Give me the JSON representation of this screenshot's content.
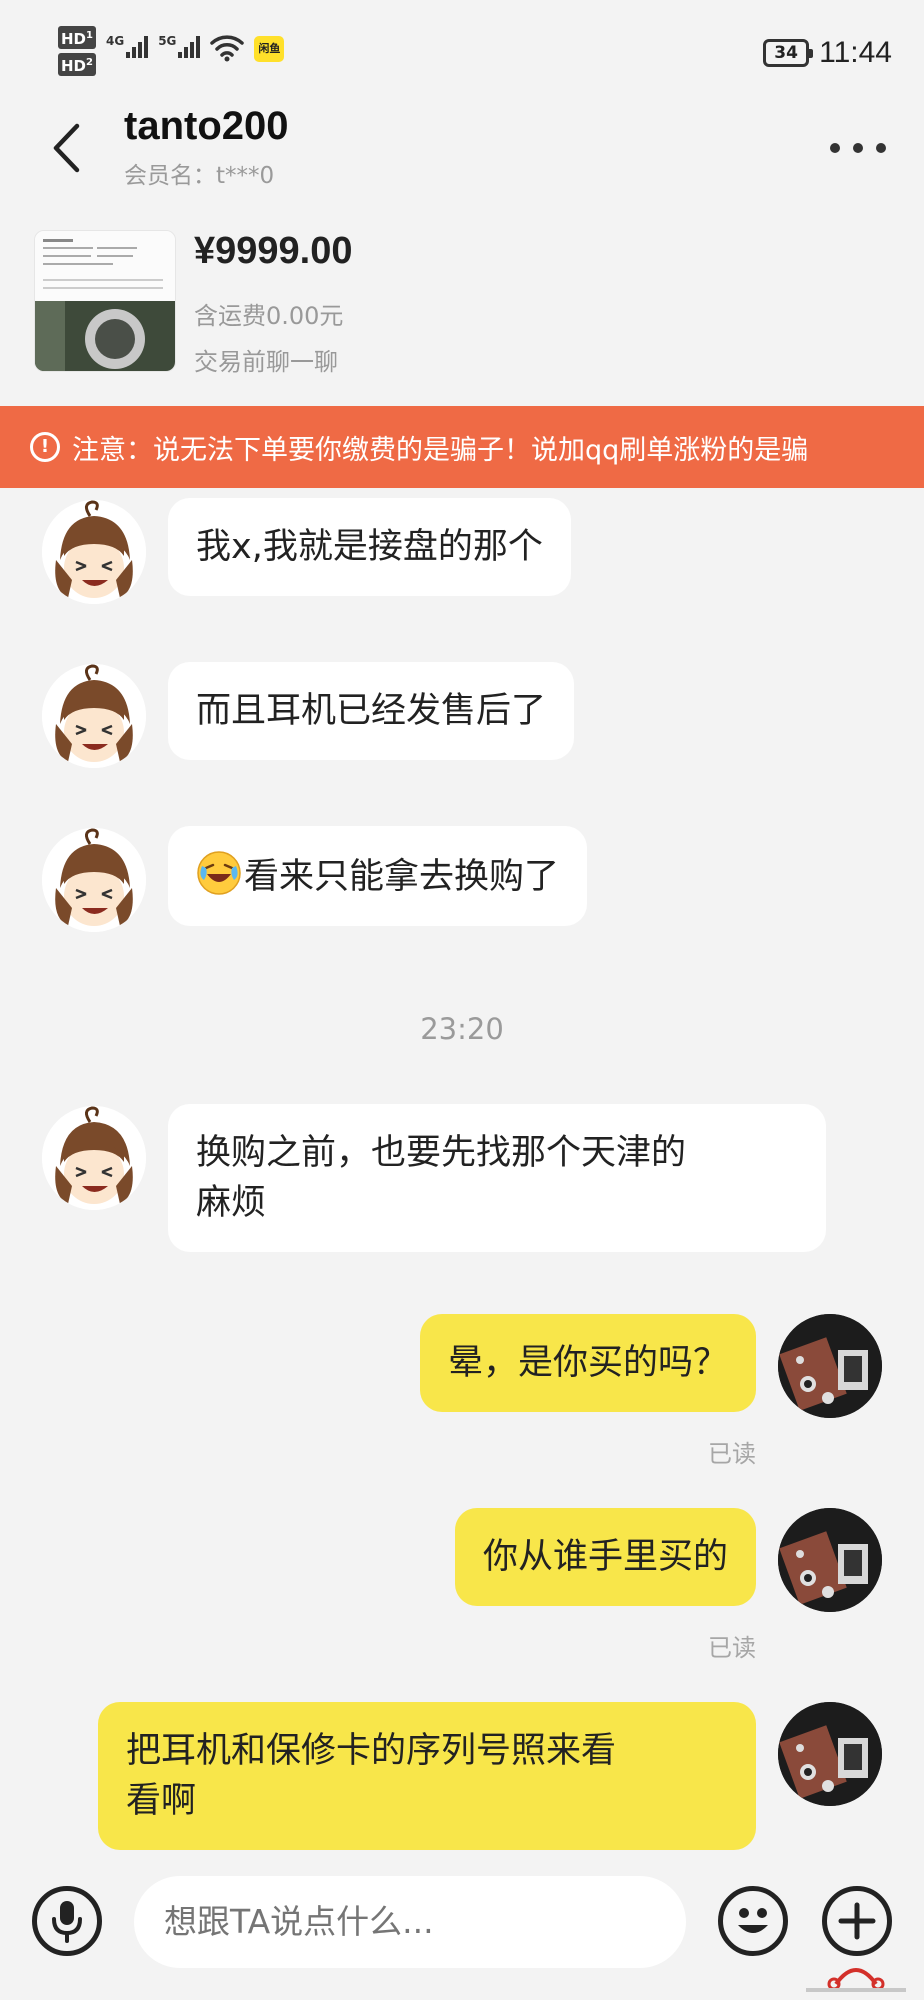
{
  "status_bar": {
    "hd1": "HD",
    "hd1_sub": "1",
    "hd2": "HD",
    "hd2_sub": "2",
    "net1": "4G",
    "net2": "5G",
    "app_badge": "闲鱼",
    "battery": "34",
    "time": "11:44"
  },
  "header": {
    "title": "tanto200",
    "member_label": "会员名：t***0"
  },
  "product": {
    "price": "¥9999.00",
    "shipping": "含运费0.00元",
    "chat_hint": "交易前聊一聊"
  },
  "warning": {
    "text": "注意：说无法下单要你缴费的是骗子！说加qq刷单涨粉的是骗"
  },
  "messages": {
    "m1": "我x,我就是接盘的那个",
    "m2": "而且耳机已经发售后了",
    "m3": "看来只能拿去换购了",
    "timestamp": "23:20",
    "m4_line1": "换购之前，也要先找那个天津的",
    "m4_line2": "麻烦",
    "m5": "晕，是你买的吗？",
    "m5_status": "已读",
    "m6": "你从谁手里买的",
    "m6_status": "已读",
    "m7_line1": "把耳机和保修卡的序列号照来看",
    "m7_line2": "看啊"
  },
  "input": {
    "placeholder": "想跟TA说点什么..."
  },
  "colors": {
    "warning_bg": "#ef6a45",
    "outgoing_bubble": "#f8e64a",
    "incoming_bubble": "#ffffff",
    "page_bg": "#f3f3f3"
  },
  "icons": {
    "back": "chevron-left-icon",
    "more": "more-dots-icon",
    "warning": "exclamation-circle-icon",
    "mic": "microphone-icon",
    "emoji": "smiley-icon",
    "plus": "plus-circle-icon"
  }
}
